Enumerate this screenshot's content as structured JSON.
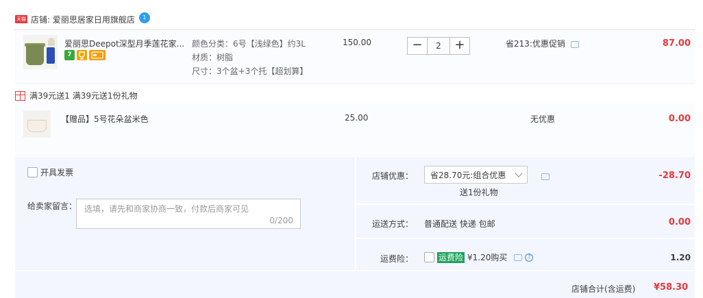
{
  "shop": {
    "badge": "天猫",
    "label": "店铺: 爱丽思居家日用旗舰店",
    "chat_badge": "1"
  },
  "item": {
    "title": "爱丽思Deepot深型月季莲花家...",
    "sku_color": "颜色分类：6号【浅绿色】约3L",
    "sku_material": "材质：树脂",
    "sku_size": "尺寸：3个盆+3个托【超划算】",
    "unit_price": "150.00",
    "quantity": "2",
    "promo": "省213:优惠促销",
    "subtotal": "87.00",
    "badges": [
      "7",
      "",
      ""
    ]
  },
  "gift": {
    "promo_line": "满39元送1    满39元送1份礼物",
    "title": "【赠品】5号花朵盆米色",
    "unit_price": "25.00",
    "promo": "无优惠",
    "subtotal": "0.00"
  },
  "order": {
    "invoice_label": "开具发票",
    "message_label": "给卖家留言：",
    "message_placeholder": "选填，请先和商家协商一致，付款后商家可见",
    "message_count": "0/200",
    "shop_discount_label": "店铺优惠：",
    "shop_discount_selected": "省28.70元:组合优惠",
    "shop_discount_note": "送1份礼物",
    "shop_discount_value": "-28.70",
    "delivery_label": "运送方式：",
    "delivery_method": "普通配送 快递 包邮",
    "delivery_value": "0.00",
    "insurance_label": "运费险：",
    "insurance_tag": "运费险",
    "insurance_price": "¥1.20购买",
    "insurance_value": "1.20",
    "total_label": "店铺合计(含运费)",
    "total_value": "¥58.30"
  },
  "colors": {
    "accent_red": "#e4393c",
    "panel_bg": "#f3f6ff",
    "insurance_green": "#1fa25c"
  }
}
